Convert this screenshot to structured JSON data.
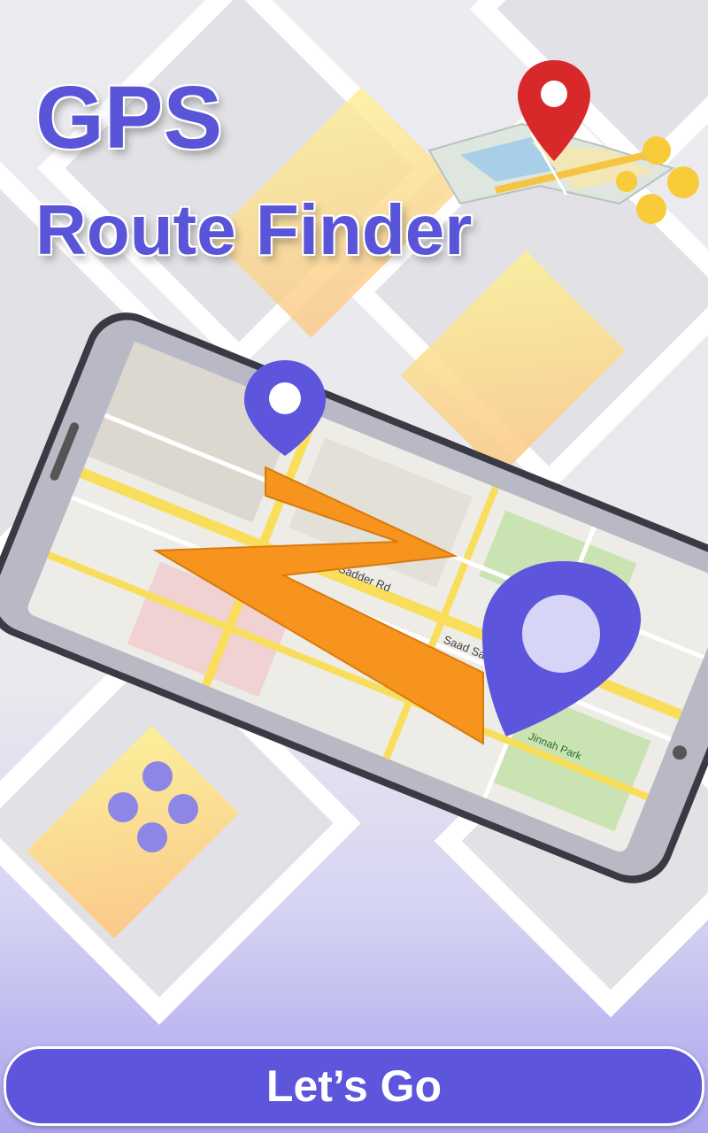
{
  "header": {
    "title_line1": "GPS",
    "title_line2": "Route Finder"
  },
  "cta": {
    "label": "Let’s Go"
  },
  "map": {
    "labels": {
      "sadder_rd": "Sadder Rd",
      "flyover": "Saad Saheed Flyover",
      "jinnah_park": "Jinnah Park"
    }
  },
  "colors": {
    "brand_purple": "#5e55dd",
    "route_orange": "#f7941d",
    "pin_red": "#d9282a",
    "tile_yellow": "#fbe48e"
  },
  "icons": [
    "map-pin-icon",
    "folded-map-icon",
    "route-z-icon",
    "dots-icon"
  ]
}
